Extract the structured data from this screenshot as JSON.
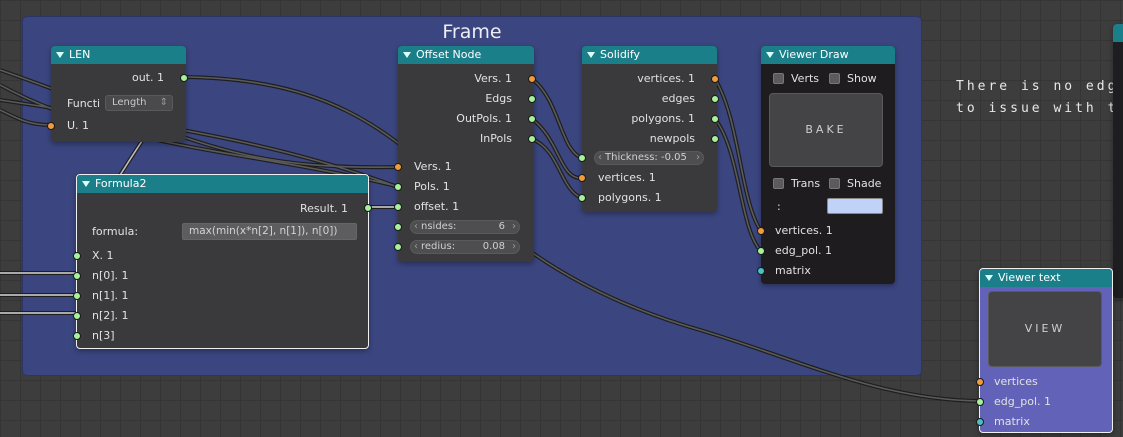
{
  "frame": {
    "title": "Frame"
  },
  "background_text": {
    "line1": "There is no edg",
    "line2": "to issue with te"
  },
  "len_node": {
    "title": "LEN",
    "out_label": "out. 1",
    "function_label": "Functi",
    "function_value": "Length",
    "input_label": "U. 1"
  },
  "offset_node": {
    "title": "Offset Node",
    "outputs": [
      "Vers. 1",
      "Edgs",
      "OutPols. 1",
      "InPols"
    ],
    "inputs": [
      "Vers. 1",
      "Pols. 1",
      "offset. 1"
    ],
    "nsides_label": "nsides:",
    "nsides_value": "6",
    "redius_label": "redius:",
    "redius_value": "0.08"
  },
  "solidify_node": {
    "title": "Solidify",
    "outputs": [
      "vertices. 1",
      "edges",
      "polygons. 1",
      "newpols"
    ],
    "thickness": "Thickness: -0.05",
    "inputs": [
      "vertices. 1",
      "polygons. 1"
    ]
  },
  "viewer_draw": {
    "title": "Viewer Draw",
    "verts_label": "Verts",
    "show_label": "Show",
    "bake_label": "BAKE",
    "trans_label": "Trans",
    "shade_label": "Shade",
    "colon": ":",
    "inputs": [
      "vertices. 1",
      "edg_pol. 1",
      "matrix"
    ],
    "color_value": "#c0d2f8"
  },
  "formula_node": {
    "title": "Formula2",
    "result_label": "Result. 1",
    "formula_label": "formula:",
    "formula_value": "max(min(x*n[2], n[1]), n[0])",
    "inputs": [
      "X. 1",
      "n[0]. 1",
      "n[1]. 1",
      "n[2]. 1",
      "n[3]"
    ]
  },
  "viewer_text": {
    "title": "Viewer text",
    "view_label": "VIEW",
    "inputs": [
      "vertices",
      "edg_pol. 1",
      "matrix"
    ]
  },
  "colors": {
    "header": "#1b7f8a",
    "frame": "#3b4680",
    "vertex_socket": "#f29a3c",
    "data_socket": "#a5f29a",
    "matrix_socket": "#49c0c4"
  }
}
